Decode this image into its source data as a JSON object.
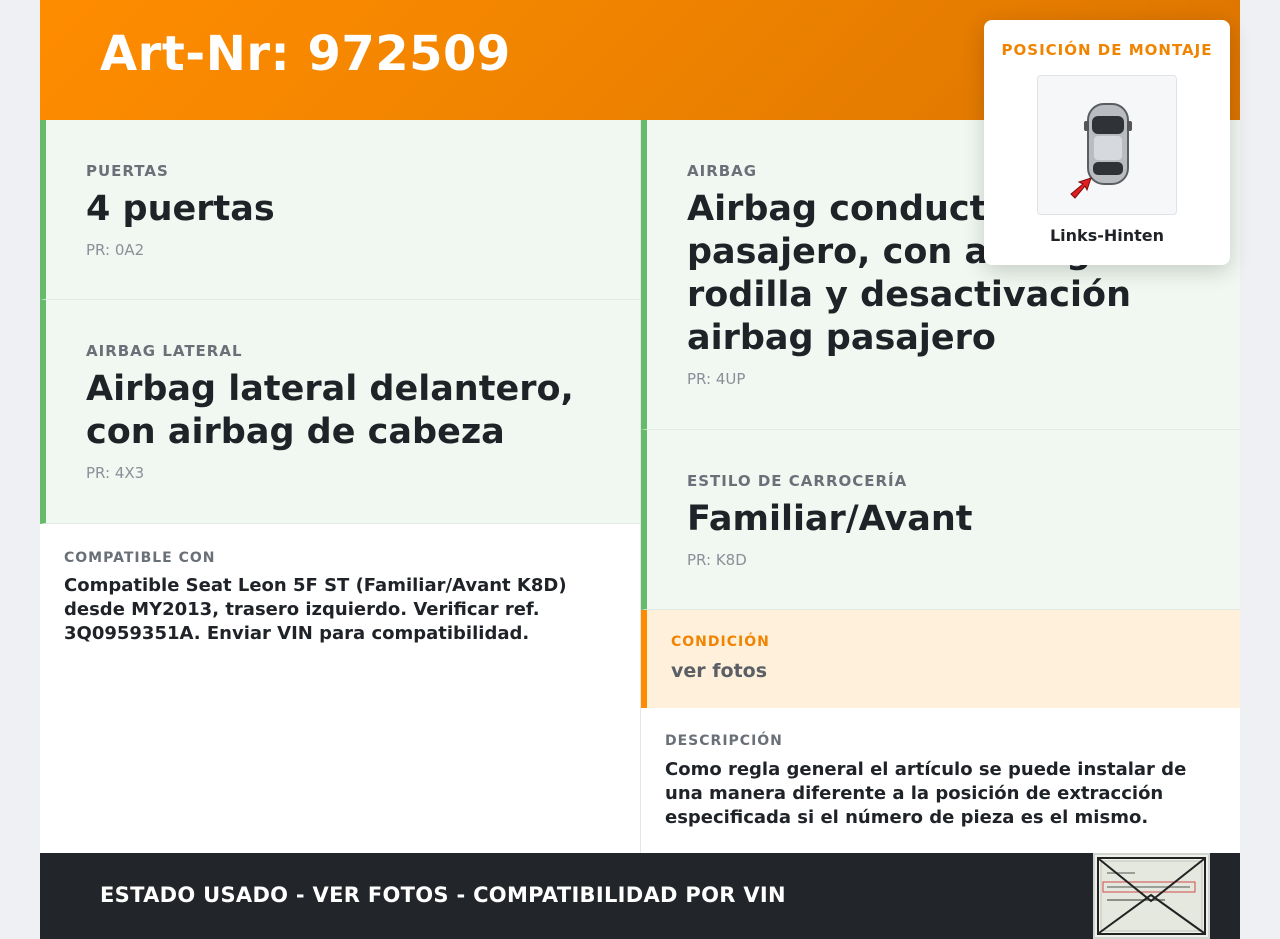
{
  "header": {
    "title": "Art-Nr: 972509"
  },
  "left_cards": [
    {
      "label": "PUERTAS",
      "value": "4 puertas",
      "pr": "PR: 0A2"
    },
    {
      "label": "AIRBAG LATERAL",
      "value": "Airbag lateral delantero, con airbag de cabeza",
      "pr": "PR: 4X3"
    }
  ],
  "right_cards": [
    {
      "label": "AIRBAG",
      "value": "Airbag conductor y pasajero, con airbag de rodilla y desactivación airbag pasajero",
      "pr": "PR: 4UP"
    },
    {
      "label": "ESTILO DE CARROCERÍA",
      "value": "Familiar/Avant",
      "pr": "PR: K8D"
    }
  ],
  "compatible": {
    "label": "COMPATIBLE CON",
    "text": "Compatible Seat Leon 5F ST (Familiar/Avant K8D) desde MY2013, trasero izquierdo. Verificar ref. 3Q0959351A. Enviar VIN para compatibilidad."
  },
  "condition": {
    "label": "CONDICIÓN",
    "text": "ver fotos"
  },
  "description": {
    "label": "DESCRIPCIÓN",
    "text": "Como regla general el artículo se puede instalar de una manera diferente a la posición de extracción especificada si el número de pieza es el mismo."
  },
  "mounting": {
    "title": "POSICIÓN DE MONTAJE",
    "position": "Links-Hinten",
    "icon": "car-top-view-icon",
    "arrow_color": "#e02020"
  },
  "footer": {
    "text": "ESTADO USADO - VER FOTOS - COMPATIBILIDAD POR VIN",
    "thumbnail_icon": "envelope-photo-icon"
  },
  "colors": {
    "brand_orange": "#ff8c00",
    "green_accent": "#66bb6a",
    "footer_bg": "#22252a"
  }
}
